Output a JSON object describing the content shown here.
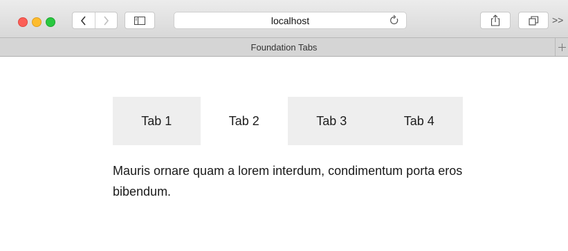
{
  "browser": {
    "url": "localhost",
    "tab_title": "Foundation Tabs",
    "more_glyph": ">>"
  },
  "tabs": [
    {
      "label": "Tab 1",
      "active": false
    },
    {
      "label": "Tab 2",
      "active": true
    },
    {
      "label": "Tab 3",
      "active": false
    },
    {
      "label": "Tab 4",
      "active": false
    }
  ],
  "panel": {
    "text": "Mauris ornare quam a lorem interdum, condimentum porta eros bibendum."
  },
  "colors": {
    "tab_inactive_bg": "#eeeeee",
    "tab_active_bg": "#ffffff"
  },
  "icons": [
    "chevron-left-icon",
    "chevron-right-icon",
    "sidebar-icon",
    "reload-icon",
    "share-icon",
    "tabs-overview-icon",
    "plus-icon"
  ]
}
